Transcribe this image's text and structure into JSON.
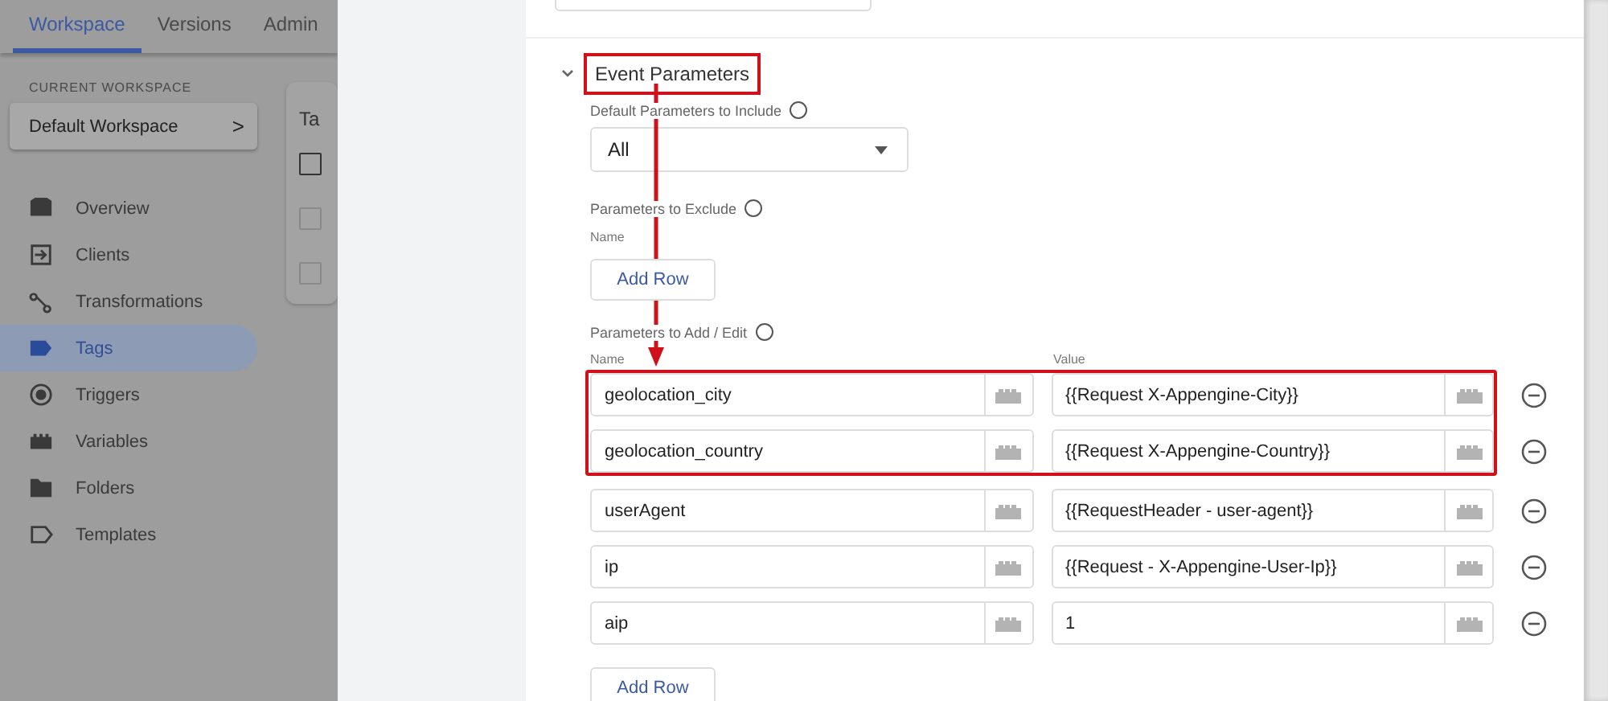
{
  "sidebar": {
    "tabs": [
      {
        "label": "Workspace",
        "selected": true
      },
      {
        "label": "Versions",
        "selected": false
      },
      {
        "label": "Admin",
        "selected": false
      }
    ],
    "workspace_label": "CURRENT WORKSPACE",
    "workspace": "Default Workspace",
    "workspace_chevron": ">",
    "items": [
      {
        "label": "Overview",
        "selected": false
      },
      {
        "label": "Clients",
        "selected": false
      },
      {
        "label": "Transformations",
        "selected": false
      },
      {
        "label": "Tags",
        "selected": true
      },
      {
        "label": "Triggers",
        "selected": false
      },
      {
        "label": "Variables",
        "selected": false
      },
      {
        "label": "Folders",
        "selected": false
      },
      {
        "label": "Templates",
        "selected": false
      }
    ]
  },
  "background_card": {
    "title": "Ta",
    "checkboxes": [
      {
        "checked": false
      },
      {
        "checked": false
      },
      {
        "checked": false
      }
    ]
  },
  "event_parameters": {
    "title": "Event Parameters",
    "expanded": true,
    "annotated": true,
    "default_include": {
      "label": "Default Parameters to Include",
      "value": "All"
    },
    "exclude": {
      "label": "Parameters to Exclude",
      "column": "Name",
      "add_button": "Add Row"
    },
    "add_edit": {
      "label": "Parameters to Add / Edit",
      "columns": [
        "Name",
        "Value"
      ],
      "rows": [
        {
          "name": "geolocation_city",
          "value": "{{Request X-Appengine-City}}",
          "highlighted": true
        },
        {
          "name": "geolocation_country",
          "value": "{{Request X-Appengine-Country}}",
          "highlighted": true
        },
        {
          "name": "userAgent",
          "value": "{{RequestHeader - user-agent}}",
          "highlighted": false
        },
        {
          "name": "ip",
          "value": "{{Request - X-Appengine-User-Ip}}",
          "highlighted": false
        },
        {
          "name": "aip",
          "value": "1",
          "highlighted": false
        }
      ],
      "add_button": "Add Row"
    }
  }
}
